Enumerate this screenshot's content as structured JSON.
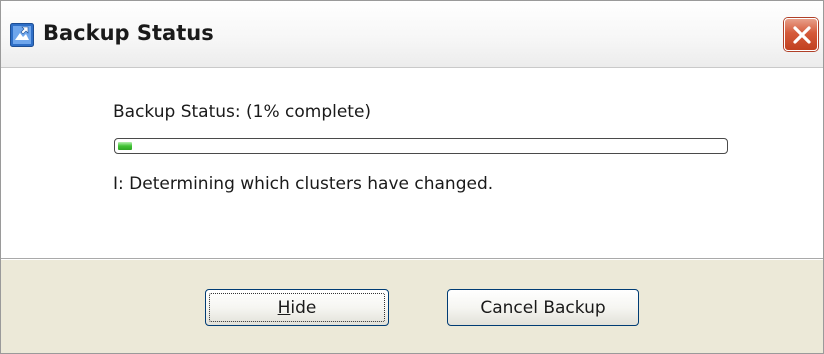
{
  "window": {
    "title": "Backup Status",
    "close_icon": "close-x-icon",
    "app_icon": "backup-app-icon"
  },
  "status": {
    "label": "Backup Status: (1% complete)",
    "progress_percent": 1,
    "detail": "I: Determining which clusters have changed."
  },
  "buttons": {
    "hide_first": "H",
    "hide_rest": "ide",
    "cancel": "Cancel Backup"
  },
  "colors": {
    "progress_green": "#41c235",
    "close_red": "#d55a3a",
    "button_border": "#003c74"
  }
}
